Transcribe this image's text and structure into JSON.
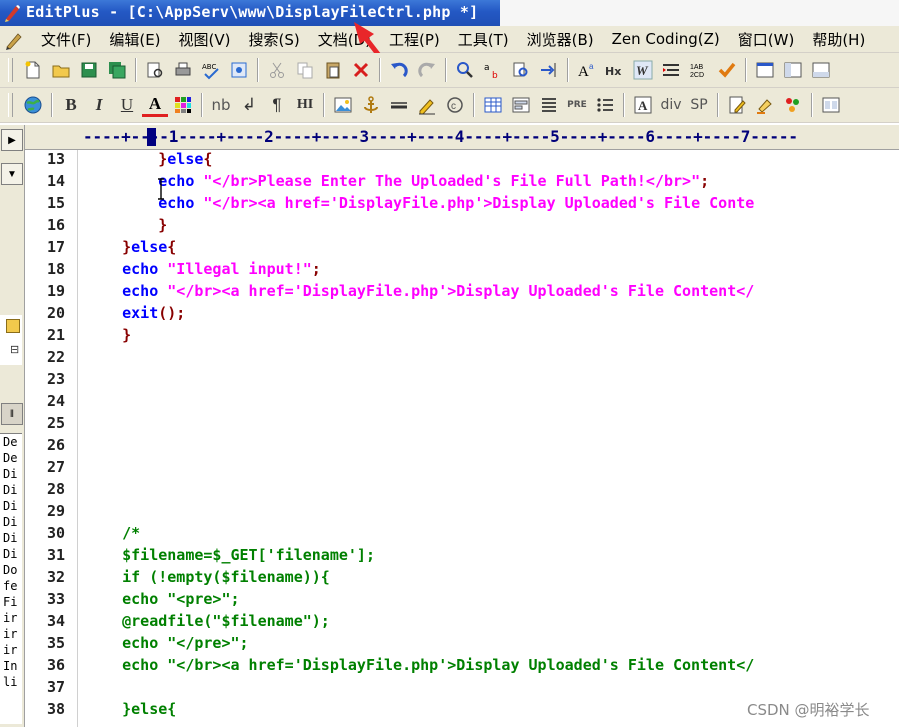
{
  "window": {
    "title": "EditPlus - [C:\\AppServ\\www\\DisplayFileCtrl.php *]"
  },
  "menu": {
    "items": [
      "文件(F)",
      "编辑(E)",
      "视图(V)",
      "搜索(S)",
      "文档(D)",
      "工程(P)",
      "工具(T)",
      "浏览器(B)",
      "Zen Coding(Z)",
      "窗口(W)",
      "帮助(H)"
    ]
  },
  "toolbar2": {
    "bold": "B",
    "italic": "I",
    "underline": "U",
    "font_color": "A",
    "nbsp": "nb",
    "br": "↲",
    "para": "¶",
    "heading": "HI",
    "pre": "PRE",
    "div": "div",
    "span": "SP"
  },
  "ruler": {
    "text": "----+----1----+----2----+----3----+----4----+----5----+----6----+----7-----"
  },
  "editor": {
    "line_numbers": [
      "13",
      "14",
      "15",
      "16",
      "17",
      "18",
      "19",
      "20",
      "21",
      "22",
      "23",
      "24",
      "25",
      "26",
      "27",
      "28",
      "29",
      "30",
      "31",
      "32",
      "33",
      "34",
      "35",
      "36",
      "37",
      "38"
    ],
    "lines": [
      {
        "segments": [
          {
            "c": "br",
            "t": "        }"
          },
          {
            "c": "kw",
            "t": "else"
          },
          {
            "c": "br",
            "t": "{"
          }
        ]
      },
      {
        "segments": [
          {
            "c": "kw",
            "t": "        echo "
          },
          {
            "c": "str",
            "t": "\"</br>Please Enter The Uploaded's File Full Path!</br>\""
          },
          {
            "c": "br",
            "t": ";"
          }
        ]
      },
      {
        "segments": [
          {
            "c": "kw",
            "t": "        echo "
          },
          {
            "c": "str",
            "t": "\"</br><a href='DisplayFile.php'>Display Uploaded's File Conte"
          }
        ]
      },
      {
        "segments": [
          {
            "c": "br",
            "t": "        }"
          }
        ]
      },
      {
        "segments": [
          {
            "c": "br",
            "t": "    }"
          },
          {
            "c": "kw",
            "t": "else"
          },
          {
            "c": "br",
            "t": "{"
          }
        ]
      },
      {
        "segments": [
          {
            "c": "kw",
            "t": "    echo "
          },
          {
            "c": "str",
            "t": "\"Illegal input!\""
          },
          {
            "c": "br",
            "t": ";"
          }
        ]
      },
      {
        "segments": [
          {
            "c": "kw",
            "t": "    echo "
          },
          {
            "c": "str",
            "t": "\"</br><a href='DisplayFile.php'>Display Uploaded's File Content</"
          }
        ]
      },
      {
        "segments": [
          {
            "c": "kw",
            "t": "    exit"
          },
          {
            "c": "br",
            "t": "();"
          }
        ]
      },
      {
        "segments": [
          {
            "c": "br",
            "t": "    }"
          }
        ]
      },
      {
        "segments": []
      },
      {
        "segments": []
      },
      {
        "segments": []
      },
      {
        "segments": []
      },
      {
        "segments": []
      },
      {
        "segments": []
      },
      {
        "segments": []
      },
      {
        "segments": []
      },
      {
        "segments": [
          {
            "c": "cm",
            "t": "    /*"
          }
        ]
      },
      {
        "segments": [
          {
            "c": "cm",
            "t": "    $filename=$_GET['filename'];"
          }
        ]
      },
      {
        "segments": [
          {
            "c": "cm",
            "t": "    if (!empty($filename)){"
          }
        ]
      },
      {
        "segments": [
          {
            "c": "cm",
            "t": "    echo \"<pre>\";"
          }
        ]
      },
      {
        "segments": [
          {
            "c": "cm",
            "t": "    @readfile(\"$filename\");"
          }
        ]
      },
      {
        "segments": [
          {
            "c": "cm",
            "t": "    echo \"</pre>\";"
          }
        ]
      },
      {
        "segments": [
          {
            "c": "cm",
            "t": "    echo \"</br><a href='DisplayFile.php'>Display Uploaded's File Content</"
          }
        ]
      },
      {
        "segments": []
      },
      {
        "segments": [
          {
            "c": "cm",
            "t": "    }else{"
          }
        ]
      }
    ]
  },
  "left_panel": {
    "list": [
      "De",
      "De",
      "Di",
      "Di",
      "Di",
      "Di",
      "Di",
      "Di",
      "Do",
      "fe",
      "Fi",
      "ir",
      "ir",
      "ir",
      "In",
      "li"
    ]
  },
  "watermark": "CSDN @明裕学长",
  "colors": {
    "keyword": "#0000ff",
    "bracket": "#880000",
    "string": "#ff00ff",
    "comment": "#008000",
    "title_bar": "#2458c4",
    "annotation_arrow": "#e8262a"
  }
}
